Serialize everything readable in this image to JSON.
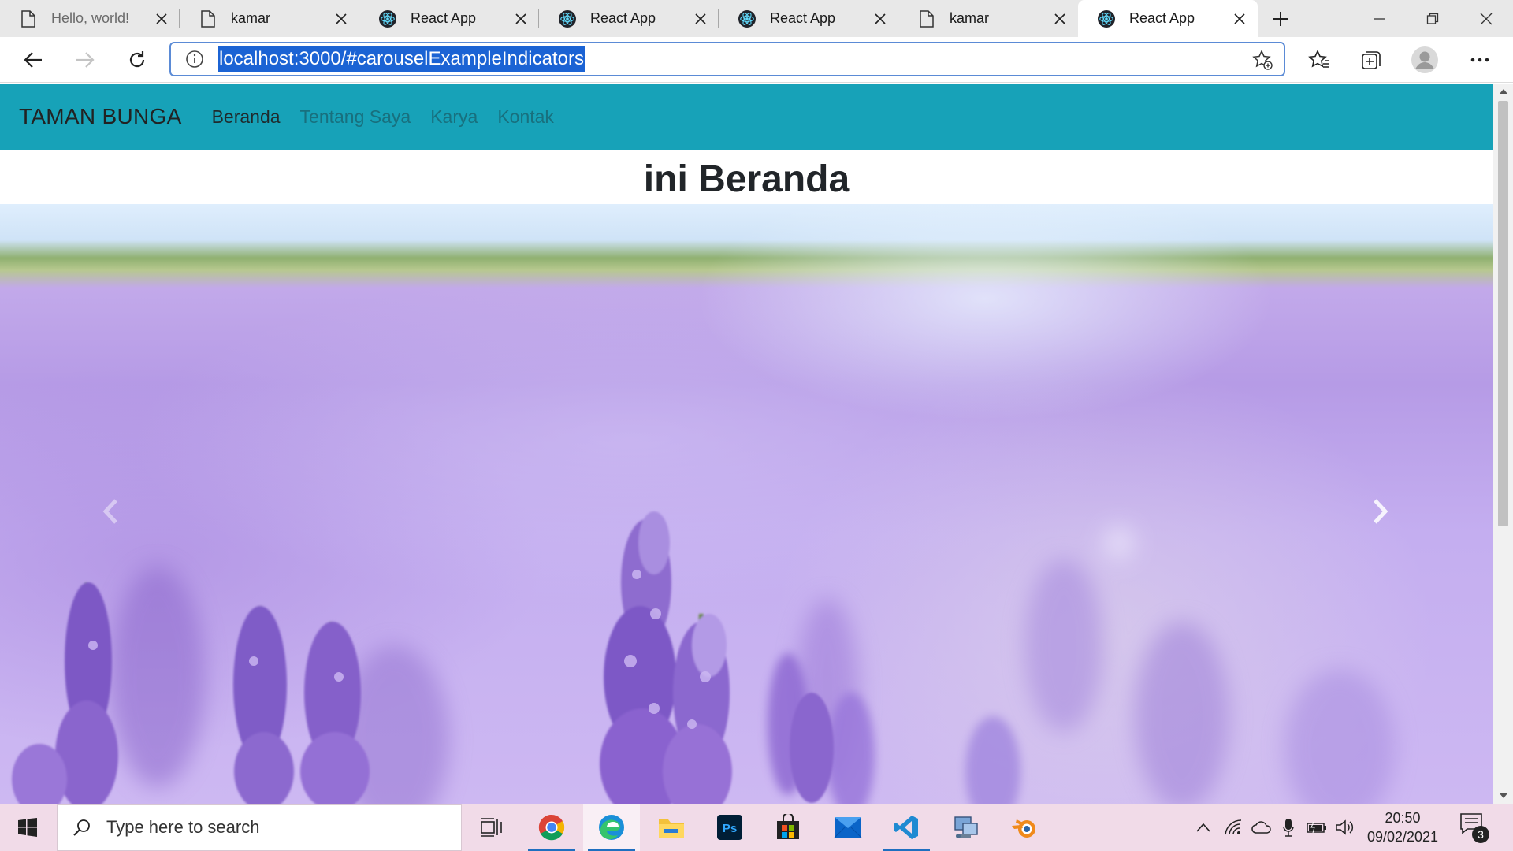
{
  "browser": {
    "tabs": [
      {
        "title": "Hello, world!",
        "icon": "page-icon",
        "state": "inactive"
      },
      {
        "title": "kamar",
        "icon": "page-icon",
        "state": "inactive"
      },
      {
        "title": "React App",
        "icon": "react-icon",
        "state": "inactive"
      },
      {
        "title": "React App",
        "icon": "react-icon",
        "state": "inactive"
      },
      {
        "title": "React App",
        "icon": "react-icon",
        "state": "inactive"
      },
      {
        "title": "kamar",
        "icon": "page-icon",
        "state": "inactive"
      },
      {
        "title": "React App",
        "icon": "react-icon",
        "state": "active"
      }
    ],
    "url": "localhost:3000/#carouselExampleIndicators",
    "accent_color": "#1b63d4"
  },
  "site": {
    "brand": "TAMAN BUNGA",
    "nav": [
      {
        "label": "Beranda",
        "active": true
      },
      {
        "label": "Tentang Saya",
        "active": false
      },
      {
        "label": "Karya",
        "active": false
      },
      {
        "label": "Kontak",
        "active": false
      }
    ],
    "navbar_color": "#17a2b8",
    "heading": "ini Beranda",
    "carousel": {
      "image": "lavender-field",
      "controls": [
        "chevron-left-icon",
        "chevron-right-icon"
      ]
    }
  },
  "taskbar": {
    "search_placeholder": "Type here to search",
    "apps": [
      "task-view-icon",
      "chrome-icon",
      "edge-icon",
      "file-explorer-icon",
      "photoshop-icon",
      "store-icon",
      "mail-icon",
      "vscode-icon",
      "network-tool-icon",
      "blender-icon"
    ],
    "time": "20:50",
    "date": "09/02/2021",
    "notification_count": "3"
  }
}
